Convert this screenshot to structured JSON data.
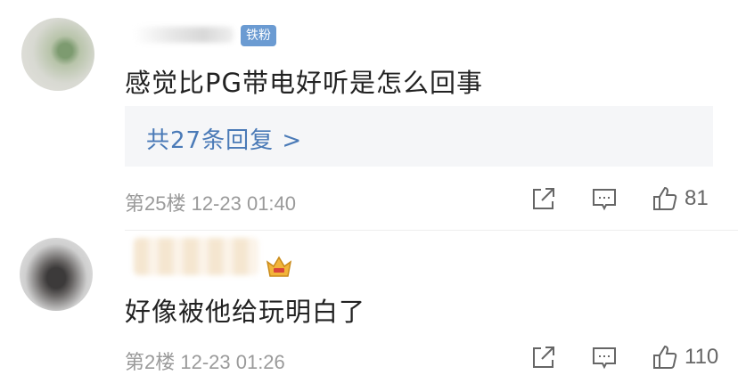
{
  "comments": [
    {
      "badge": "铁粉",
      "text": "感觉比PG带电好听是怎么回事",
      "replies_label": "共27条回复 >",
      "meta": "第25楼 12-23 01:40",
      "like_count": "81"
    },
    {
      "text": "好像被他给玩明白了",
      "meta": "第2楼 12-23 01:26",
      "like_count": "110"
    }
  ],
  "colors": {
    "link": "#4a7ab7",
    "badge": "#6b9bd2",
    "meta": "#9a9a9a"
  },
  "icons": [
    "share-icon",
    "comment-icon",
    "thumbs-up-icon",
    "crown-icon"
  ]
}
